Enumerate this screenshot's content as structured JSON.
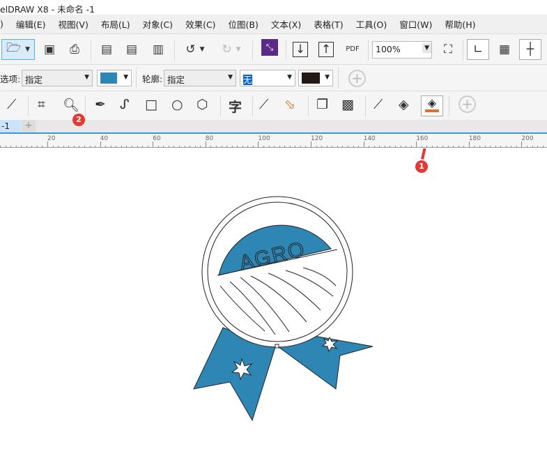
{
  "window": {
    "title": "elDRAW X8 - 未命名 -1"
  },
  "menu": [
    "编辑(E)",
    "视图(V)",
    "布局(L)",
    "对象(C)",
    "效果(C)",
    "位图(B)",
    "文本(X)",
    "表格(T)",
    "工具(O)",
    "窗口(W)",
    "帮助(H)"
  ],
  "toolbar": {
    "zoom_value": "100%",
    "pdf_label": "PDF"
  },
  "propbar": {
    "fill_label": "选项:",
    "fill_mode": "指定",
    "fill_color": "#2e86b4",
    "outline_label": "轮廓:",
    "outline_mode": "指定",
    "outline_width": "无",
    "outline_color": "#231815"
  },
  "toolbox": {
    "text_tool": "字"
  },
  "tabs": {
    "doc_tab": "-1",
    "add": "+"
  },
  "ruler": {
    "labels": [
      "20",
      "40",
      "60",
      "80",
      "100",
      "120",
      "140",
      "160",
      "180",
      "200"
    ]
  },
  "canvas": {
    "badge_text": "AGRO",
    "ribbon_color": "#2e86b4"
  },
  "annotations": {
    "a1": "1",
    "a2": "2"
  }
}
